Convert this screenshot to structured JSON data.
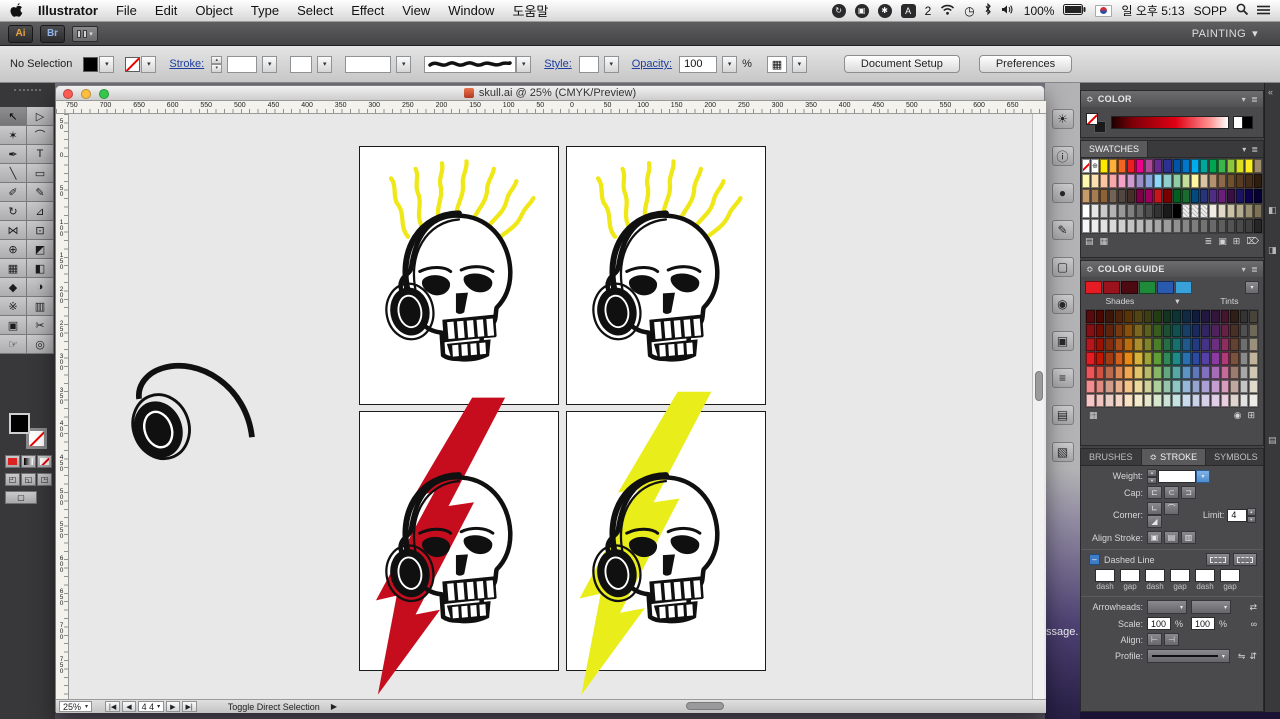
{
  "menu_bar": {
    "app_name": "Illustrator",
    "items": [
      "File",
      "Edit",
      "Object",
      "Type",
      "Select",
      "Effect",
      "View",
      "Window",
      "도움말"
    ],
    "status": {
      "sync_glyph": "↻",
      "camera_glyph": "▣",
      "paw_glyph": "✱",
      "input_badge": "A",
      "input_count": "2",
      "activity_glyph": "◷",
      "battery_percent": "100%",
      "clock": "일 오후 5:13",
      "user": "SOPP"
    }
  },
  "app_bar": {
    "ai_badge": "Ai",
    "br_badge": "Br",
    "workspace": "PAINTING"
  },
  "control_bar": {
    "selection_status": "No Selection",
    "stroke_label": "Stroke:",
    "style_label": "Style:",
    "opacity_label": "Opacity:",
    "opacity_value": "100",
    "opacity_unit": "%",
    "document_setup_button": "Document Setup",
    "preferences_button": "Preferences"
  },
  "tools": [
    {
      "name": "selection-tool",
      "glyph": "↖",
      "active": true
    },
    {
      "name": "direct-selection-tool",
      "glyph": "▷"
    },
    {
      "name": "magic-wand-tool",
      "glyph": "✶"
    },
    {
      "name": "lasso-tool",
      "glyph": "⌒"
    },
    {
      "name": "pen-tool",
      "glyph": "✒"
    },
    {
      "name": "type-tool",
      "glyph": "T"
    },
    {
      "name": "line-segment-tool",
      "glyph": "╲"
    },
    {
      "name": "rectangle-tool",
      "glyph": "▭"
    },
    {
      "name": "paintbrush-tool",
      "glyph": "✐"
    },
    {
      "name": "pencil-tool",
      "glyph": "✎"
    },
    {
      "name": "rotate-tool",
      "glyph": "↻"
    },
    {
      "name": "scale-tool",
      "glyph": "⊿"
    },
    {
      "name": "width-tool",
      "glyph": "⋈"
    },
    {
      "name": "free-transform-tool",
      "glyph": "⊡"
    },
    {
      "name": "shape-builder-tool",
      "glyph": "⊕"
    },
    {
      "name": "perspective-grid-tool",
      "glyph": "◩"
    },
    {
      "name": "mesh-tool",
      "glyph": "▦"
    },
    {
      "name": "gradient-tool",
      "glyph": "◧"
    },
    {
      "name": "eyedropper-tool",
      "glyph": "◆"
    },
    {
      "name": "blend-tool",
      "glyph": "◑"
    },
    {
      "name": "symbol-sprayer-tool",
      "glyph": "※"
    },
    {
      "name": "column-graph-tool",
      "glyph": "▥"
    },
    {
      "name": "artboard-tool",
      "glyph": "▣"
    },
    {
      "name": "slice-tool",
      "glyph": "✂"
    },
    {
      "name": "hand-tool",
      "glyph": "☞"
    },
    {
      "name": "zoom-tool",
      "glyph": "◎"
    }
  ],
  "icon_dock": [
    {
      "name": "kuler-panel-icon",
      "glyph": "☀"
    },
    {
      "name": "info-panel-icon",
      "glyph": "ⓘ"
    },
    {
      "name": "appearance-panel-icon",
      "glyph": "●"
    },
    {
      "name": "graphic-styles-panel-icon",
      "glyph": "✎"
    },
    {
      "name": "transparency-panel-icon",
      "glyph": "▢"
    },
    {
      "name": "symbols-panel-icon",
      "glyph": "◉"
    },
    {
      "name": "transform-panel-icon",
      "glyph": "▣"
    },
    {
      "name": "align-panel-icon",
      "glyph": "≡"
    },
    {
      "name": "pathfinder-panel-icon",
      "glyph": "▤"
    },
    {
      "name": "layers-panel-icon",
      "glyph": "▧"
    }
  ],
  "right_strip": [
    "«",
    "◧",
    "◨",
    "▤"
  ],
  "document": {
    "title": "skull.ai @ 25% (CMYK/Preview)",
    "zoom": "25%",
    "artboard_nav_value": "4 4",
    "nav": [
      "|◀",
      "◀",
      "▶",
      "▶|"
    ],
    "tool_hint": "Toggle Direct Selection",
    "ruler_top": [
      "750",
      "700",
      "650",
      "600",
      "550",
      "500",
      "450",
      "400",
      "350",
      "300",
      "250",
      "200",
      "150",
      "100",
      "50",
      "0",
      "50",
      "100",
      "150",
      "200",
      "250",
      "300",
      "350",
      "400",
      "450",
      "500",
      "550",
      "600",
      "650"
    ],
    "ruler_left": [
      "50",
      "0",
      "50",
      "100",
      "150",
      "200",
      "250",
      "300",
      "350",
      "400",
      "450",
      "500",
      "550",
      "600",
      "650",
      "700",
      "750"
    ]
  },
  "background_window_fragment": "ssage.",
  "icons": {
    "collapse": "≎",
    "panel_menu": "≣",
    "dropdown": "▾",
    "swap": "⇄",
    "link": "∞",
    "flip_h": "⇋",
    "flip_v": "⇵",
    "stepper_up": "▴",
    "stepper_down": "▾",
    "play": "▶",
    "checkbox_dash": "–",
    "registration": "⊕",
    "select_similar": "▦"
  },
  "artwork": {
    "ray_color": "#f0e716",
    "bolt_red": "#c60d1e",
    "bolt_yellow": "#e9ed1a"
  },
  "panels": {
    "color": {
      "title": "COLOR"
    },
    "swatches": {
      "title": "SWATCHES",
      "controls": [
        "▤",
        "▦",
        "≣",
        "▣",
        "⊞",
        "⌦"
      ],
      "grid": [
        [
          "none",
          "reg",
          "#ffe800",
          "#fbb03b",
          "#f26522",
          "#ed1c24",
          "#ec008c",
          "#b04a98",
          "#662d91",
          "#2e3192",
          "#0054a6",
          "#0077c8",
          "#00adee",
          "#00a79b",
          "#00a551",
          "#39b54a",
          "#8cc63e",
          "#d9e021",
          "#fcee21",
          "#9e8a6c"
        ],
        [
          "#fff9b2",
          "#fde0b2",
          "#fbc6a0",
          "#f9a8a9",
          "#f5a0c6",
          "#cf9ad0",
          "#9b8dc8",
          "#8aa5dc",
          "#8ed8f8",
          "#8fd0cc",
          "#8dd0a5",
          "#c4df9b",
          "#fff5a2",
          "#d9c6a4",
          "#b49271",
          "#8c6a49",
          "#70512e",
          "#5a3d21",
          "#472c1a",
          "#2e1c0e"
        ],
        [
          "#c69c6d",
          "#a67c52",
          "#8c6239",
          "#736357",
          "#534741",
          "#453029",
          "#7b0046",
          "#9e005d",
          "#c4161c",
          "#790000",
          "#005e20",
          "#1a6b30",
          "#004a80",
          "#27347a",
          "#4d2e82",
          "#6b1f7c",
          "#3a0f44",
          "#1b1464",
          "#0d004c",
          "#060033"
        ],
        [
          "#ffffff",
          "#e6e6e6",
          "#cccccc",
          "#b3b3b3",
          "#999999",
          "#808080",
          "#666666",
          "#4d4d4d",
          "#333333",
          "#1a1a1a",
          "#000000",
          "pat",
          "pat",
          "pat",
          "#f2ede4",
          "#e0d8c8",
          "#ccc2a8",
          "#b5ab8e",
          "#998f72",
          "#7d7257"
        ],
        [
          "#f7f7f7",
          "#ededed",
          "#e3e3e3",
          "#d9d9d9",
          "#cfcfcf",
          "#c4c4c4",
          "#bababa",
          "#b0b0b0",
          "#a6a6a6",
          "#9c9c9c",
          "#919191",
          "#878787",
          "#7d7d7d",
          "#737373",
          "#696969",
          "#5e5e5e",
          "#545454",
          "#4a4a4a",
          "#404040",
          "#262626"
        ]
      ]
    },
    "color_guide": {
      "title": "COLOR GUIDE",
      "shades_label": "Shades",
      "tints_label": "Tints",
      "controls": [
        "▦",
        "◉",
        "⊞"
      ],
      "harmony": [
        "#e51c23",
        "#99121c",
        "#4d0a10",
        "#1f8a3a",
        "#2a5ab0",
        "#3aa0d8"
      ],
      "base_colors": [
        "#e51c23",
        "#c21500",
        "#a33a12",
        "#d2601a",
        "#e98a17",
        "#d8b23a",
        "#a0a338",
        "#5f9e34",
        "#2f8a57",
        "#1f8a8a",
        "#2a6fb0",
        "#2b4aa0",
        "#5540a8",
        "#8a3aa0",
        "#b03a78",
        "#7a5240",
        "#8a8a8a",
        "#c0b49a"
      ],
      "rows": [
        -0.62,
        -0.42,
        -0.2,
        0,
        0.25,
        0.5,
        0.75
      ]
    },
    "stroke": {
      "tabs": [
        "BRUSHES",
        "STROKE",
        "SYMBOLS"
      ],
      "weight_label": "Weight:",
      "weight_value": "",
      "cap_label": "Cap:",
      "cap_buttons": [
        "⊏",
        "⊂",
        "⊐"
      ],
      "corner_label": "Corner:",
      "corner_buttons": [
        "∟",
        "⌒",
        "◢"
      ],
      "limit_label": "Limit:",
      "limit_value": "4",
      "align_label": "Align Stroke:",
      "align_buttons": [
        "▣",
        "▤",
        "▥"
      ],
      "dashed_label": "Dashed Line",
      "dash_gap_labels": [
        "dash",
        "gap",
        "dash",
        "gap",
        "dash",
        "gap"
      ],
      "arrowheads_label": "Arrowheads:",
      "scale_label": "Scale:",
      "scale_value_1": "100",
      "scale_value_2": "100",
      "percent": "%",
      "align2_label": "Align:",
      "align2_buttons": [
        "⊢",
        "⊣"
      ],
      "profile_label": "Profile:"
    }
  }
}
